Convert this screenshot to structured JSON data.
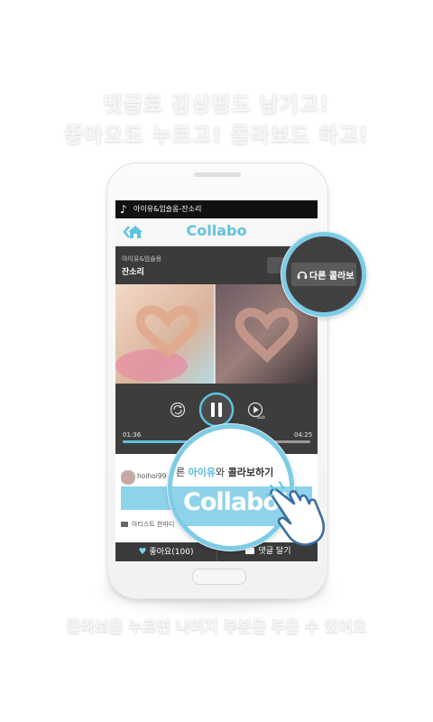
{
  "promo": {
    "headline_1": "댓글로 감상평도 남기고!",
    "headline_2": "좋아요도 누르고! 콜라보도 하고!",
    "caption": "콜라보를 누르면 나머지 부분을 부를 수 있어요"
  },
  "app": {
    "status_song": "아이유&임슬옹-잔소리",
    "title": "Collabo",
    "icons": {
      "back": "chevron-left-icon",
      "home": "home-icon",
      "note": "music-note-icon"
    },
    "song": {
      "artist": "아이유&임슬옹",
      "track": "잔소리"
    },
    "other_collabo_label": "다른 콜라보",
    "player": {
      "current_time": "01:36",
      "total_time": "04:25",
      "progress": 0.34,
      "controls": [
        "repeat-icon",
        "pause-icon",
        "auto-play-icon"
      ],
      "auto_label": "auto"
    },
    "comment": {
      "username": "hoihoi99",
      "collabo_prompt_prefix": "른 ",
      "collabo_prompt_artist": "아이유",
      "collabo_prompt_mid": "와 ",
      "collabo_prompt_action": "콜라보하기",
      "collabo_button_label": "Collabo!",
      "artist_note": "아티스트 한마디"
    },
    "actions": {
      "like": "좋아요(100)",
      "comment": "댓글 달기"
    }
  },
  "colors": {
    "accent": "#5ec3df",
    "dark": "#3a3a3a",
    "ring": "#7ecbe4"
  }
}
